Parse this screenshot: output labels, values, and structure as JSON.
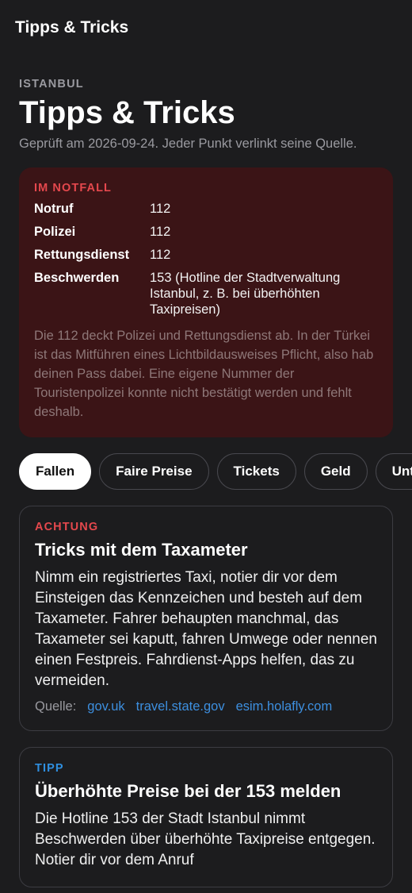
{
  "topbar": {
    "title": "Tipps & Tricks"
  },
  "header": {
    "eyebrow": "ISTANBUL",
    "title": "Tipps & Tricks",
    "subtitle": "Geprüft am 2026-09-24. Jeder Punkt verlinkt seine Quelle."
  },
  "emergency": {
    "heading": "IM NOTFALL",
    "rows": [
      {
        "label": "Notruf",
        "value": "112"
      },
      {
        "label": "Polizei",
        "value": "112"
      },
      {
        "label": "Rettungsdienst",
        "value": "112"
      },
      {
        "label": "Beschwerden",
        "value": "153 (Hotline der Stadtverwaltung Istanbul, z. B. bei überhöhten Taxipreisen)"
      }
    ],
    "note": "Die 112 deckt Polizei und Rettungsdienst ab. In der Türkei ist das Mitführen eines Lichtbildausweises Pflicht, also hab deinen Pass dabei. Eine eigene Nummer der Touristenpolizei konnte nicht bestätigt werden und fehlt deshalb."
  },
  "tabs": [
    {
      "label": "Fallen",
      "active": true
    },
    {
      "label": "Faire Preise",
      "active": false
    },
    {
      "label": "Tickets",
      "active": false
    },
    {
      "label": "Geld",
      "active": false
    },
    {
      "label": "Unt",
      "active": false
    }
  ],
  "cards": [
    {
      "tag": "ACHTUNG",
      "title": "Tricks mit dem Taxameter",
      "body": "Nimm ein registriertes Taxi, notier dir vor dem Einsteigen das Kennzeichen und besteh auf dem Taxameter. Fahrer behaupten manchmal, das Taxameter sei kaputt, fahren Umwege oder nennen einen Festpreis. Fahrdienst-Apps helfen, das zu vermeiden.",
      "sources_label": "Quelle:",
      "sources": [
        "gov.uk",
        "travel.state.gov",
        "esim.holafly.com"
      ]
    },
    {
      "tag": "TIPP",
      "title": "Überhöhte Preise bei der 153 melden",
      "body": "Die Hotline 153 der Stadt Istanbul nimmt Beschwerden über überhöhte Taxipreise entgegen. Notier dir vor dem Anruf"
    }
  ],
  "colors": {
    "background": "#1c1c1e",
    "warn": "#e5484d",
    "tip": "#2f8fe0",
    "link": "#3d8fdf",
    "emergency_bg": "#3b1416"
  }
}
